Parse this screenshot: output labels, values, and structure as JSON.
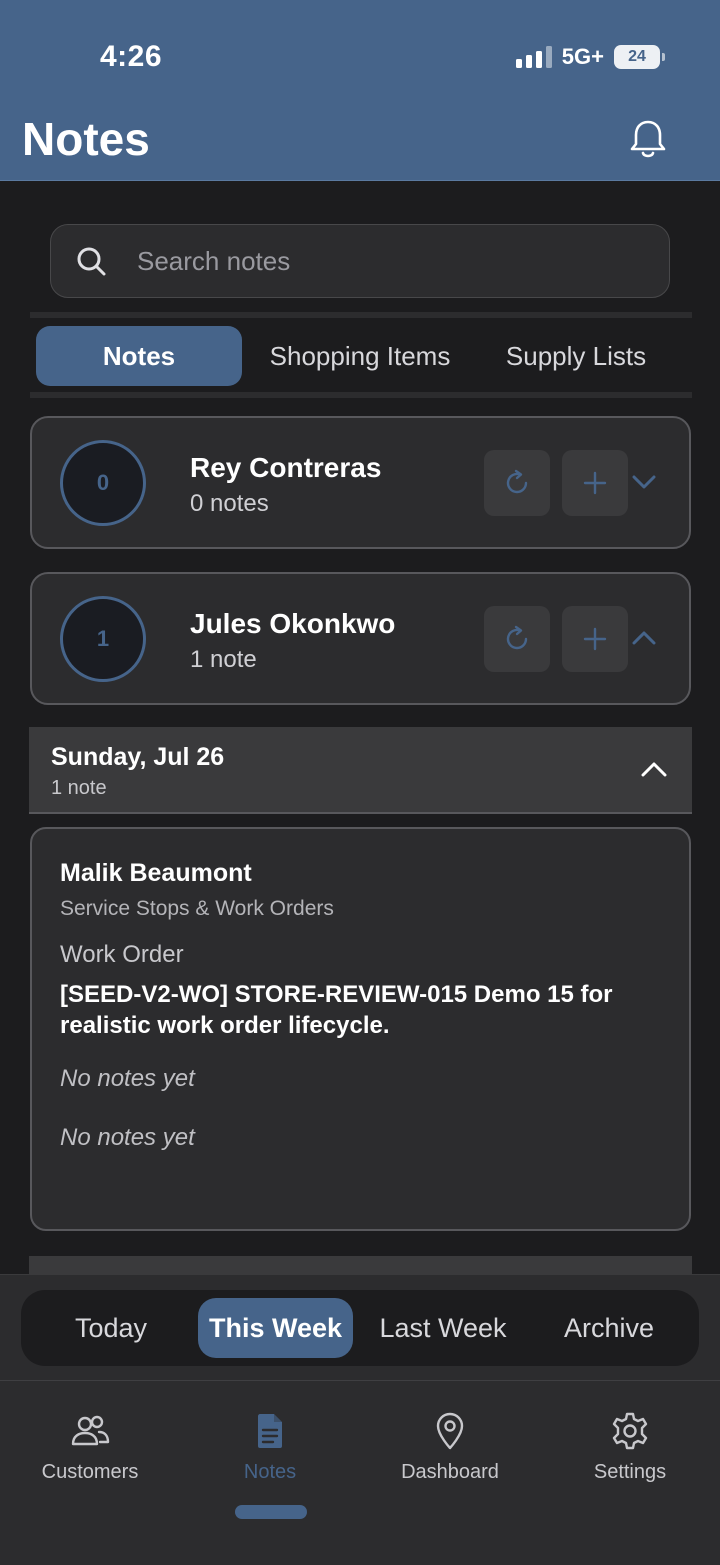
{
  "status_bar": {
    "time": "4:26",
    "network": "5G+",
    "battery": "24"
  },
  "header": {
    "title": "Notes",
    "bell_icon": "bell-icon"
  },
  "search": {
    "placeholder": "Search notes",
    "icon": "search-icon"
  },
  "tabs": [
    {
      "label": "Notes",
      "active": true
    },
    {
      "label": "Shopping Items",
      "active": false
    },
    {
      "label": "Supply Lists",
      "active": false
    }
  ],
  "customers": [
    {
      "count": "0",
      "name": "Rey Contreras",
      "notes_label": "0 notes",
      "expanded": false
    },
    {
      "count": "1",
      "name": "Jules Okonkwo",
      "notes_label": "1 note",
      "expanded": true
    }
  ],
  "date_group": {
    "title": "Sunday, Jul 26",
    "subtitle": "1 note"
  },
  "note": {
    "name": "Malik Beaumont",
    "category": "Service Stops & Work Orders",
    "type": "Work Order",
    "title": "[SEED-V2-WO] STORE-REVIEW-015 Demo 15 for realistic work order lifecycle.",
    "empty_1": "No notes yet",
    "empty_2": "No notes yet"
  },
  "periods": [
    {
      "label": "Today",
      "active": false
    },
    {
      "label": "This Week",
      "active": true
    },
    {
      "label": "Last Week",
      "active": false
    },
    {
      "label": "Archive",
      "active": false
    }
  ],
  "nav": [
    {
      "label": "Customers",
      "icon": "users-icon",
      "active": false
    },
    {
      "label": "Notes",
      "icon": "document-icon",
      "active": true
    },
    {
      "label": "Dashboard",
      "icon": "map-pin-icon",
      "active": false
    },
    {
      "label": "Settings",
      "icon": "gear-icon",
      "active": false
    }
  ],
  "colors": {
    "accent": "#46648a",
    "background": "#1c1c1e",
    "surface": "#2c2c2e"
  }
}
